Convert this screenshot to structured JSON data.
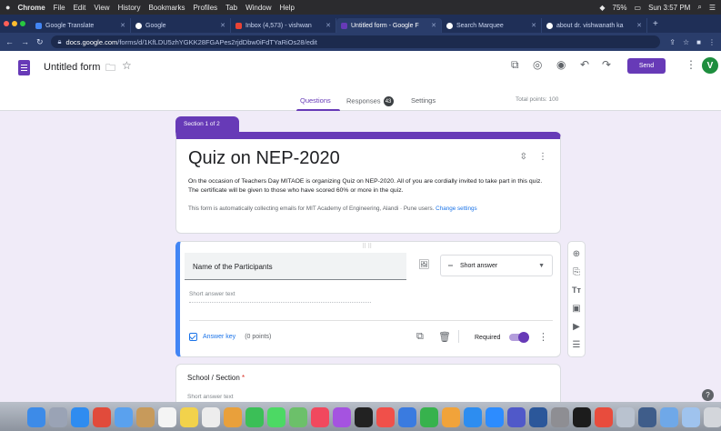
{
  "mac_menubar": {
    "app": "Chrome",
    "menus": [
      "File",
      "Edit",
      "View",
      "History",
      "Bookmarks",
      "Profiles",
      "Tab",
      "Window",
      "Help"
    ],
    "battery": "75%",
    "clock": "Sun 3:57 PM"
  },
  "browser": {
    "tabs": [
      {
        "label": "Google Translate",
        "color": "#4285f4"
      },
      {
        "label": "Google",
        "color": "#ffffff"
      },
      {
        "label": "Inbox (4,573) - vishwan",
        "color": "#ea4335"
      },
      {
        "label": "Untitled form - Google F",
        "color": "#673ab7",
        "active": true
      },
      {
        "label": "Search Marquee",
        "color": "#ffffff"
      },
      {
        "label": "about dr. vishwanath ka",
        "color": "#ffffff"
      }
    ],
    "new_tab": "+",
    "url_domain": "docs.google.com",
    "url_path": "/forms/d/1KfLDU5zhYGKK28FGAPes2rjdDbw0iFdTYaRiOs28/edit"
  },
  "forms_header": {
    "title": "Untitled form",
    "send_label": "Send",
    "avatar_letter": "V",
    "tabs": [
      {
        "label": "Questions",
        "active": true
      },
      {
        "label": "Responses",
        "badge": "43"
      },
      {
        "label": "Settings"
      }
    ],
    "total_points": "Total points: 100"
  },
  "section": {
    "label": "Section 1 of 2"
  },
  "title_card": {
    "title": "Quiz on NEP-2020",
    "description": "On the occasion of Teachers Day MITAOE is organizing Quiz on NEP-2020. All of you are cordially invited to take part in this quiz.  The certificate will be given to those who have scored 60% or more in the quiz.",
    "email_note": "This form is automatically collecting emails for MIT Academy of Engineering, Alandi · Pune users.",
    "change_settings": "Change settings"
  },
  "question1": {
    "title": "Name of the Participants",
    "type": "Short answer",
    "placeholder": "Short answer text",
    "answer_key": "Answer key",
    "points": "(0 points)",
    "required_label": "Required",
    "required": true
  },
  "question2": {
    "title": "School / Section",
    "required_mark": "*",
    "placeholder": "Short answer text"
  },
  "floating_toolbar": [
    "add-question",
    "import-questions",
    "add-title",
    "add-image",
    "add-video",
    "add-section"
  ],
  "colors": {
    "accent": "#673ab7",
    "focus_border": "#4285f4",
    "page_bg": "#f0ebf8",
    "link": "#1a73e8"
  }
}
